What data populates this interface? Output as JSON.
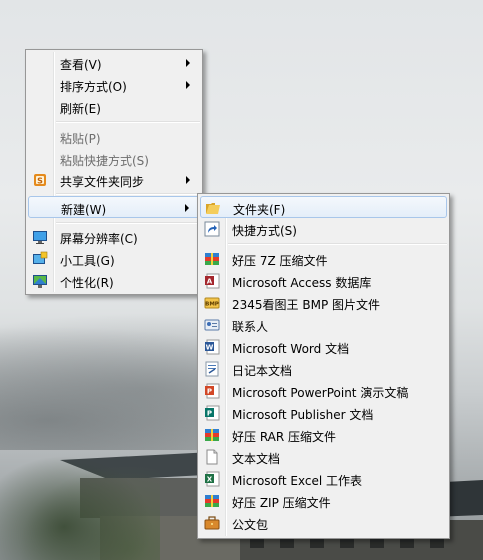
{
  "main_menu": {
    "items": [
      {
        "label": "查看(V)",
        "submenu": true
      },
      {
        "label": "排序方式(O)",
        "submenu": true
      },
      {
        "label": "刷新(E)"
      },
      {
        "label": "粘贴(P)",
        "disabled": true
      },
      {
        "label": "粘贴快捷方式(S)",
        "disabled": true
      },
      {
        "label": "共享文件夹同步",
        "submenu": true,
        "icon": "share-sync-icon"
      },
      {
        "label": "新建(W)",
        "submenu": true,
        "highlighted": true
      },
      {
        "label": "屏幕分辨率(C)",
        "icon": "screen-resolution-icon"
      },
      {
        "label": "小工具(G)",
        "icon": "gadgets-icon"
      },
      {
        "label": "个性化(R)",
        "icon": "personalize-icon"
      }
    ]
  },
  "new_submenu": {
    "items": [
      {
        "label": "文件夹(F)",
        "icon": "folder-icon",
        "highlighted": true
      },
      {
        "label": "快捷方式(S)",
        "icon": "shortcut-icon"
      },
      {
        "label": "好压 7Z 压缩文件",
        "icon": "haozip-7z-icon"
      },
      {
        "label": "Microsoft Access 数据库",
        "icon": "access-icon"
      },
      {
        "label": "2345看图王 BMP 图片文件",
        "icon": "bmp-icon"
      },
      {
        "label": "联系人",
        "icon": "contact-icon"
      },
      {
        "label": "Microsoft Word 文档",
        "icon": "word-icon"
      },
      {
        "label": "日记本文档",
        "icon": "journal-icon"
      },
      {
        "label": "Microsoft PowerPoint 演示文稿",
        "icon": "powerpoint-icon"
      },
      {
        "label": "Microsoft Publisher 文档",
        "icon": "publisher-icon"
      },
      {
        "label": "好压 RAR 压缩文件",
        "icon": "haozip-rar-icon"
      },
      {
        "label": "文本文档",
        "icon": "text-document-icon"
      },
      {
        "label": "Microsoft Excel 工作表",
        "icon": "excel-icon"
      },
      {
        "label": "好压 ZIP 压缩文件",
        "icon": "haozip-zip-icon"
      },
      {
        "label": "公文包",
        "icon": "briefcase-icon"
      }
    ]
  }
}
